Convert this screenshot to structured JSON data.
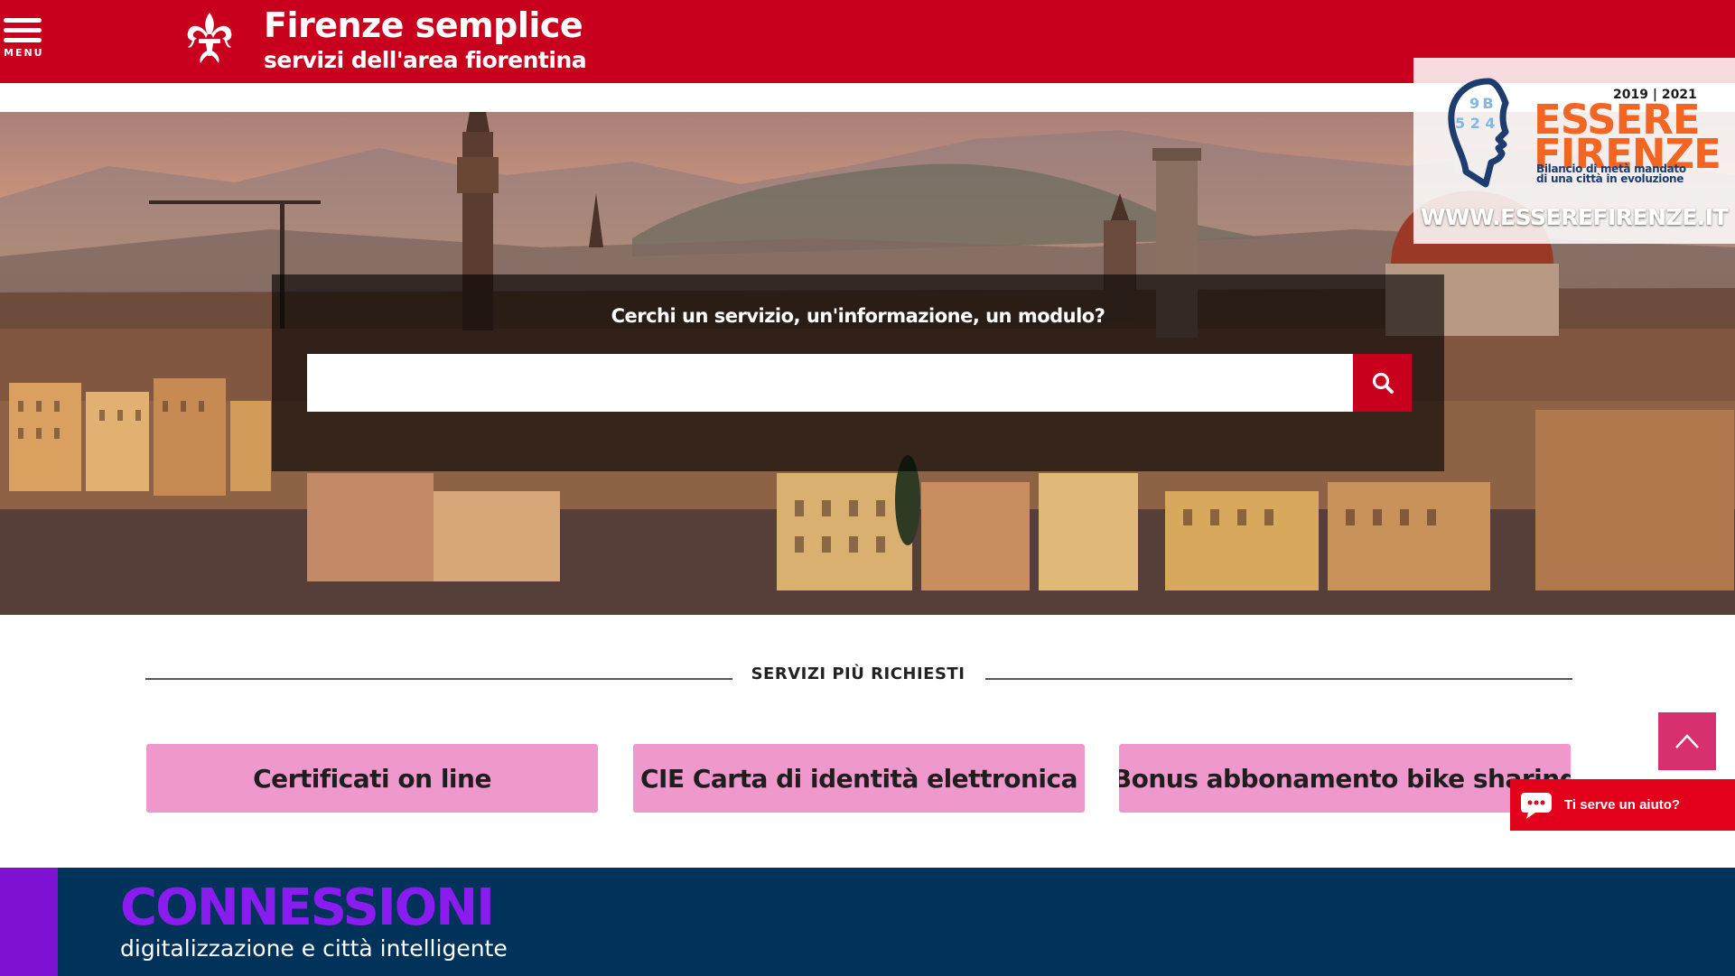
{
  "header": {
    "menu_label": "MENU",
    "title": "Firenze semplice",
    "subtitle": "servizi dell'area fiorentina",
    "logo_icon": "fleur-de-lis-icon",
    "menu_icon": "hamburger-icon"
  },
  "search": {
    "question": "Cerchi un servizio, un'informazione, un modulo?",
    "value": "",
    "placeholder": "",
    "button_icon": "search-icon"
  },
  "promo": {
    "years": "2019 | 2021",
    "title_line1": "ESSERE",
    "title_line2": "FIRENZE",
    "tagline_line1": "Bilancio di metà mandato",
    "tagline_line2": "di una città in evoluzione",
    "url": "WWW.ESSEREFIRENZE.IT"
  },
  "servizi": {
    "heading": "SERVIZI PIÙ RICHIESTI",
    "items": [
      {
        "label": "Certificati on line"
      },
      {
        "label": "CIE Carta di identità elettronica"
      },
      {
        "label": "Bonus abbonamento bike sharing"
      }
    ]
  },
  "help": {
    "label": "Ti serve un aiuto?",
    "icon": "chat-bubble-icon"
  },
  "scroll_top_icon": "chevron-up-icon",
  "banner": {
    "title": "CONNESSIONI",
    "subtitle": "digitalizzazione e città intelligente"
  },
  "colors": {
    "header_red": "#c8001e",
    "service_pink": "#ee98cb",
    "banner_navy": "#00325a",
    "banner_purple": "#8a1cf0",
    "promo_orange": "#f26522"
  }
}
